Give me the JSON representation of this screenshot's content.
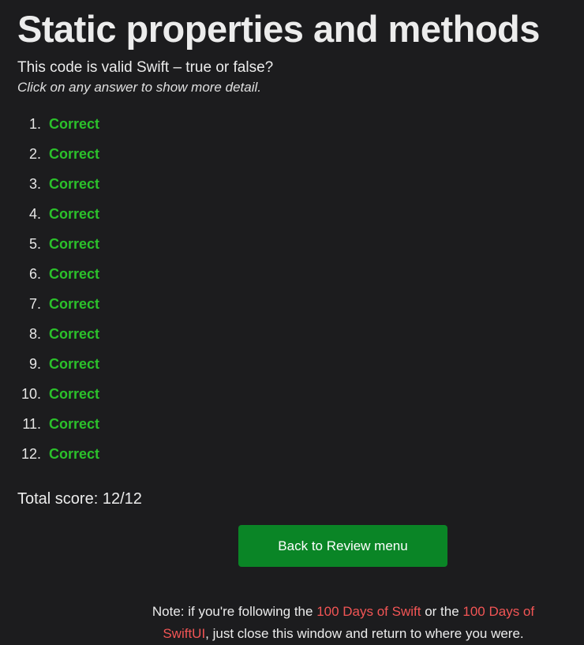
{
  "header": {
    "title": "Static properties and methods",
    "question": "This code is valid Swift – true or false?",
    "hint": "Click on any answer to show more detail."
  },
  "answers": [
    {
      "number": "1.",
      "result": "Correct"
    },
    {
      "number": "2.",
      "result": "Correct"
    },
    {
      "number": "3.",
      "result": "Correct"
    },
    {
      "number": "4.",
      "result": "Correct"
    },
    {
      "number": "5.",
      "result": "Correct"
    },
    {
      "number": "6.",
      "result": "Correct"
    },
    {
      "number": "7.",
      "result": "Correct"
    },
    {
      "number": "8.",
      "result": "Correct"
    },
    {
      "number": "9.",
      "result": "Correct"
    },
    {
      "number": "10.",
      "result": "Correct"
    },
    {
      "number": "11.",
      "result": "Correct"
    },
    {
      "number": "12.",
      "result": "Correct"
    }
  ],
  "score": {
    "label": "Total score: 12/12"
  },
  "actions": {
    "back_label": "Back to Review menu"
  },
  "note": {
    "prefix": "Note: if you're following the ",
    "link1": "100 Days of Swift",
    "middle": " or the ",
    "link2": "100 Days of SwiftUI",
    "suffix": ", just close this window and return to where you were."
  },
  "colors": {
    "background": "#1c1c1e",
    "correct": "#2bc02b",
    "button": "#0a8526",
    "link": "#f25555"
  }
}
